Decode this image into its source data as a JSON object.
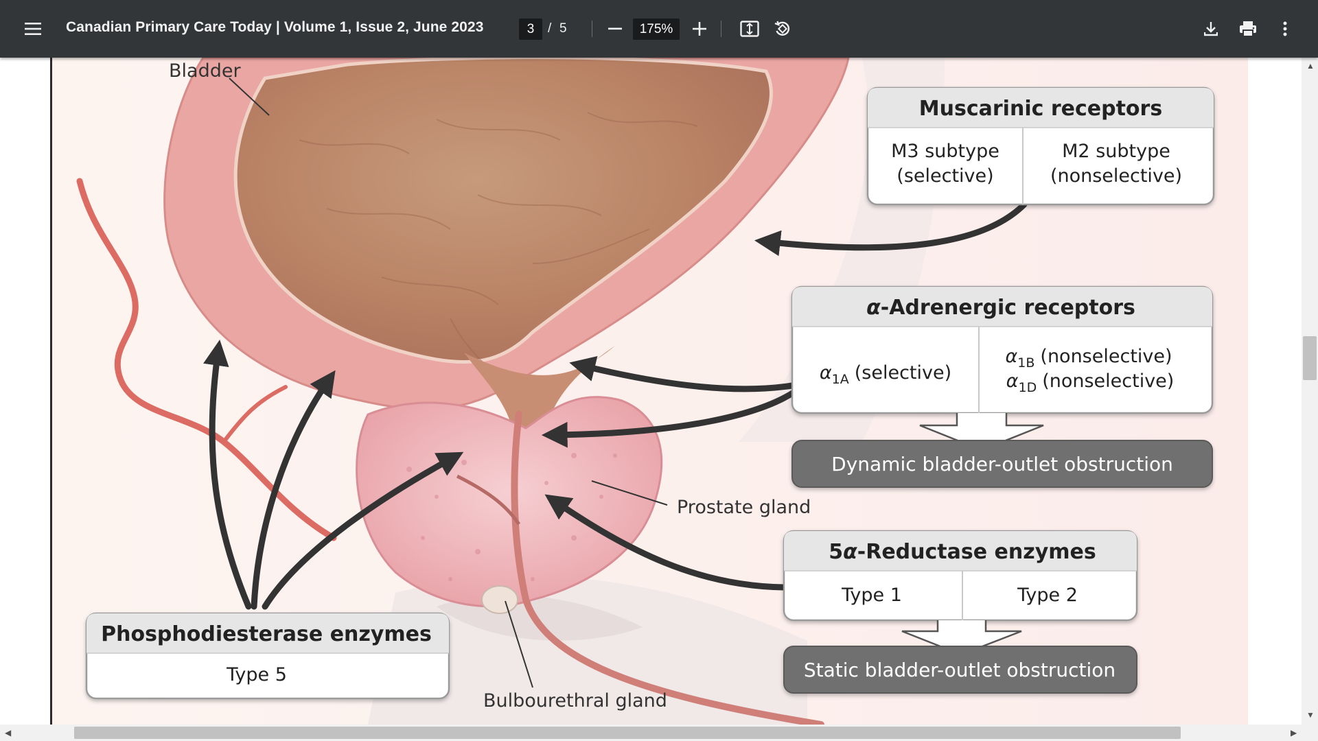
{
  "toolbar": {
    "title": "Canadian Primary Care Today | Volume 1, Issue 2, June 2023",
    "page_current": "3",
    "page_separator": "/",
    "page_total": "5",
    "zoom": "175%",
    "icons": [
      "menu-icon",
      "zoom-out-icon",
      "zoom-in-icon",
      "fit-page-icon",
      "rotate-icon",
      "download-icon",
      "print-icon",
      "more-icon"
    ]
  },
  "figure": {
    "labels": {
      "bladder": "Bladder",
      "prostate": "Prostate gland",
      "bulbourethral": "Bulbourethral gland"
    },
    "muscarinic": {
      "title": "Muscarinic receptors",
      "left_line1": "M3 subtype",
      "left_line2": "(selective)",
      "right_line1": "M2 subtype",
      "right_line2": "(nonselective)"
    },
    "adrenergic": {
      "title_alpha": "α",
      "title_rest": "-Adrenergic receptors",
      "a1a_sub": "1A",
      "a1a_text": "(selective)",
      "a1b_sub": "1B",
      "a1b_text": "(nonselective)",
      "a1d_sub": "1D",
      "a1d_text": "(nonselective)",
      "alpha": "α"
    },
    "dynamic": "Dynamic bladder-outlet obstruction",
    "reductase": {
      "title_prefix": "5",
      "title_alpha": "α",
      "title_rest": "-Reductase enzymes",
      "type1": "Type 1",
      "type2": "Type 2"
    },
    "static": "Static bladder-outlet obstruction",
    "pde": {
      "title": "Phosphodiesterase enzymes",
      "type": "Type 5"
    }
  },
  "colors": {
    "toolbar_bg": "#323639",
    "box_header": "#e6e6e6",
    "obstruction_box": "#6f6f6f",
    "arrow": "#333333",
    "bladder_wall": "#e9a3a0",
    "prostate": "#f0b9bd"
  }
}
